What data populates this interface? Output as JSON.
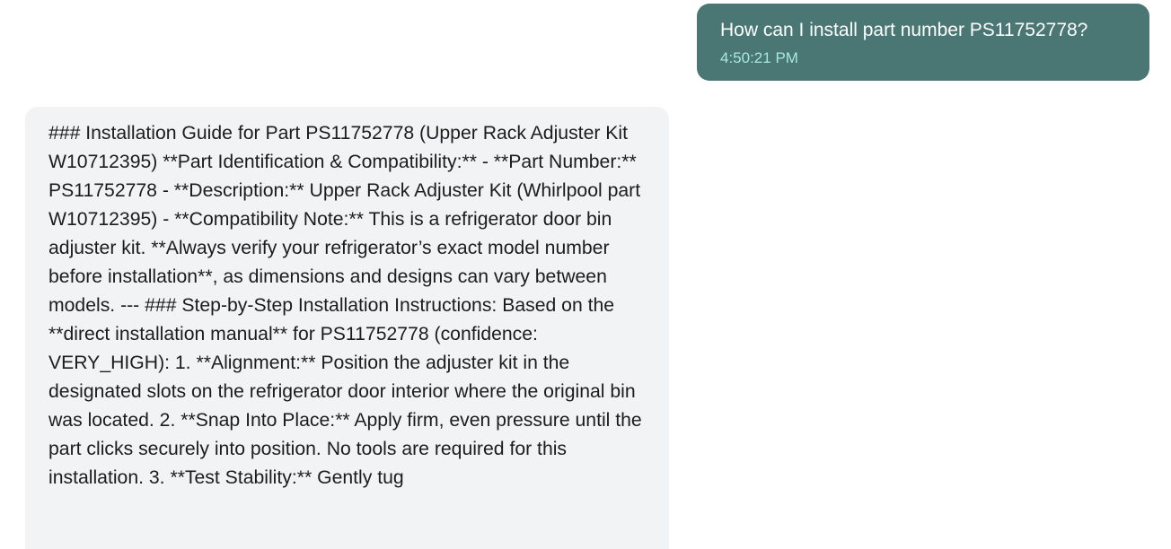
{
  "conversation": {
    "user_message": {
      "text": "How can I install part number PS11752778?",
      "time": "4:50:21 PM"
    },
    "assistant_message": {
      "text": "### Installation Guide for Part PS11752778 (Upper Rack Adjuster Kit W10712395) **Part Identification & Compatibility:** - **Part Number:** PS11752778 - **Description:** Upper Rack Adjuster Kit (Whirlpool part W10712395) - **Compatibility Note:** This is a refrigerator door bin adjuster kit. **Always verify your refrigerator’s exact model number before installation**, as dimensions and designs can vary between models. --- ### Step-by-Step Installation Instructions: Based on the **direct installation manual** for PS11752778 (confidence: VERY_HIGH): 1. **Alignment:** Position the adjuster kit in the designated slots on the refrigerator door interior where the original bin was located. 2. **Snap Into Place:** Apply firm, even pressure until the part clicks securely into position. No tools are required for this installation. 3. **Test Stability:** Gently tug"
    }
  },
  "colors": {
    "user_bubble_bg": "#4a7673",
    "user_time": "#a8e8dc",
    "assistant_bubble_bg": "#f2f3f5",
    "text_dark": "#1c1c1e"
  }
}
